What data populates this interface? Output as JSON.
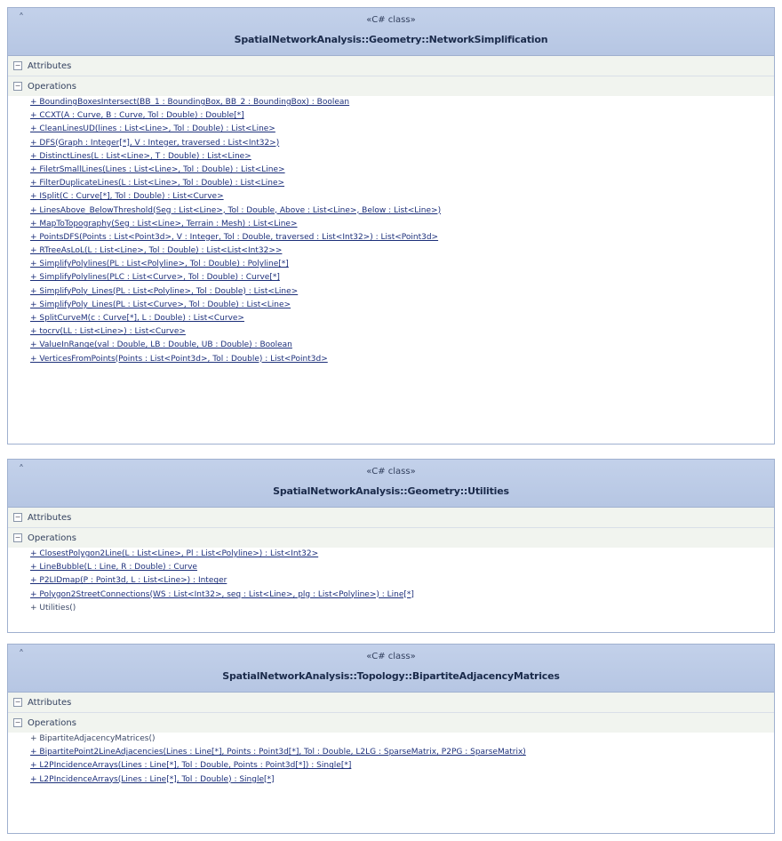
{
  "diagram": {
    "classes": [
      {
        "stereotype": "«C# class»",
        "name": "SpatialNetworkAnalysis::Geometry::NetworkSimplification",
        "attributes_label": "Attributes",
        "operations_label": "Operations",
        "operations": [
          {
            "text": "+ BoundingBoxesIntersect(BB_1 : BoundingBox, BB_2 : BoundingBox) : Boolean",
            "static": true
          },
          {
            "text": "+ CCXT(A : Curve, B : Curve, Tol : Double) : Double[*]",
            "static": true
          },
          {
            "text": "+ CleanLinesUD(lines : List<Line>, Tol : Double) : List<Line>",
            "static": true
          },
          {
            "text": "+ DFS(Graph : Integer[*], V : Integer, traversed : List<Int32>)",
            "static": true
          },
          {
            "text": "+ DistinctLines(L : List<Line>, T : Double) : List<Line>",
            "static": true
          },
          {
            "text": "+ FiletrSmallLines(Lines : List<Line>, Tol : Double) : List<Line>",
            "static": true
          },
          {
            "text": "+ FilterDuplicateLines(L : List<Line>, Tol : Double) : List<Line>",
            "static": true
          },
          {
            "text": "+ ISplit(C : Curve[*], Tol : Double) : List<Curve>",
            "static": true
          },
          {
            "text": "+ LinesAbove_BelowThreshold(Seg : List<Line>, Tol : Double, Above : List<Line>, Below : List<Line>)",
            "static": true
          },
          {
            "text": "+ MapToTopography(Seg : List<Line>, Terrain : Mesh) : List<Line>",
            "static": true
          },
          {
            "text": "+ PointsDFS(Points : List<Point3d>, V : Integer, Tol : Double, traversed : List<Int32>) : List<Point3d>",
            "static": true
          },
          {
            "text": "+ RTreeAsLoL(L : List<Line>, Tol : Double) : List<List<Int32>>",
            "static": true
          },
          {
            "text": "+ SimplifyPolylines(PL : List<Polyline>, Tol : Double) : Polyline[*]",
            "static": true
          },
          {
            "text": "+ SimplifyPolylines(PLC : List<Curve>, Tol : Double) : Curve[*]",
            "static": true
          },
          {
            "text": "+ SimplifyPoly_Lines(PL : List<Polyline>, Tol : Double) : List<Line>",
            "static": true
          },
          {
            "text": "+ SimplifyPoly_Lines(PL : List<Curve>, Tol : Double) : List<Line>",
            "static": true
          },
          {
            "text": "+ SplitCurveM(c : Curve[*], L : Double) : List<Curve>",
            "static": true
          },
          {
            "text": "+ tocrv(LL : List<Line>) : List<Curve>",
            "static": true
          },
          {
            "text": "+ ValueInRange(val : Double, LB : Double, UB : Double) : Boolean",
            "static": true
          },
          {
            "text": "+ VerticesFromPoints(Points : List<Point3d>, Tol : Double) : List<Point3d>",
            "static": true
          }
        ]
      },
      {
        "stereotype": "«C# class»",
        "name": "SpatialNetworkAnalysis::Geometry::Utilities",
        "attributes_label": "Attributes",
        "operations_label": "Operations",
        "operations": [
          {
            "text": "+ ClosestPolygon2Line(L : List<Line>, Pl : List<Polyline>) : List<Int32>",
            "static": true
          },
          {
            "text": "+ LineBubble(L : Line, R : Double) : Curve",
            "static": true
          },
          {
            "text": "+ P2LIDmap(P : Point3d, L : List<Line>) : Integer",
            "static": true
          },
          {
            "text": "+ Polygon2StreetConnections(WS : List<Int32>, seq : List<Line>, plg : List<Polyline>) : Line[*]",
            "static": true
          },
          {
            "text": "+ Utilities()",
            "static": false
          }
        ]
      },
      {
        "stereotype": "«C# class»",
        "name": "SpatialNetworkAnalysis::Topology::BipartiteAdjacencyMatrices",
        "attributes_label": "Attributes",
        "operations_label": "Operations",
        "operations": [
          {
            "text": "+ BipartiteAdjacencyMatrices()",
            "static": false
          },
          {
            "text": "+ BipartitePoint2LineAdjacencies(Lines : Line[*], Points : Point3d[*], Tol : Double, L2LG : SparseMatrix, P2PG : SparseMatrix)",
            "static": true
          },
          {
            "text": "+ L2PIncidenceArrays(Lines : Line[*], Tol : Double, Points : Point3d[*]) : Single[*]",
            "static": true
          },
          {
            "text": "+ L2PIncidenceArrays(Lines : Line[*], Tol : Double) : Single[*]",
            "static": true
          }
        ]
      }
    ]
  }
}
